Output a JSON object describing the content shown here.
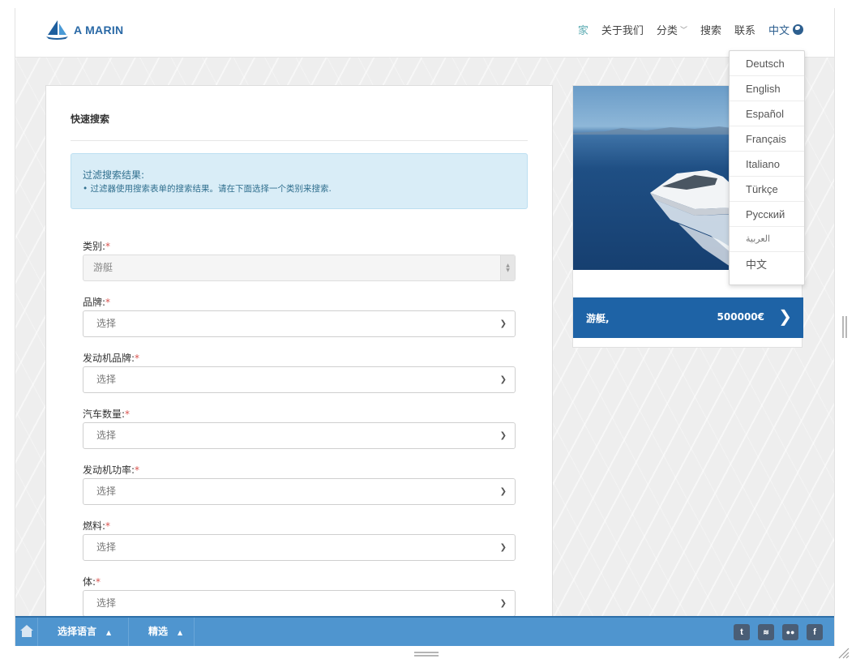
{
  "header": {
    "logo_text": "A MARIN",
    "nav": [
      {
        "label": "家"
      },
      {
        "label": "关于我们"
      },
      {
        "label": "分类"
      },
      {
        "label": "搜索"
      },
      {
        "label": "联系"
      },
      {
        "label": "中文"
      }
    ]
  },
  "search": {
    "title": "快速搜索",
    "alert_title": "过滤搜索结果:",
    "alert_text": "• 过滤器使用搜索表单的搜索结果。请在下面选择一个类别来搜索.",
    "fields": [
      {
        "label": "类别:",
        "value": "游艇"
      },
      {
        "label": "品牌:",
        "value": "选择"
      },
      {
        "label": "发动机品牌:",
        "value": "选择"
      },
      {
        "label": "汽车数量:",
        "value": "选择"
      },
      {
        "label": "发动机功率:",
        "value": "选择"
      },
      {
        "label": "燃料:",
        "value": "选择"
      },
      {
        "label": "体:",
        "value": "选择"
      }
    ],
    "required_mark": "*"
  },
  "listing": {
    "name": "游艇,",
    "price": "500000€"
  },
  "language_menu": [
    "Deutsch",
    "English",
    "Español",
    "Français",
    "Italiano",
    "Türkçe",
    "Русский",
    "العربية",
    "中文"
  ],
  "toolbar": {
    "select_language": "选择语言",
    "featured": "精选",
    "social": [
      "t",
      "rss",
      "flickr",
      "f"
    ]
  }
}
